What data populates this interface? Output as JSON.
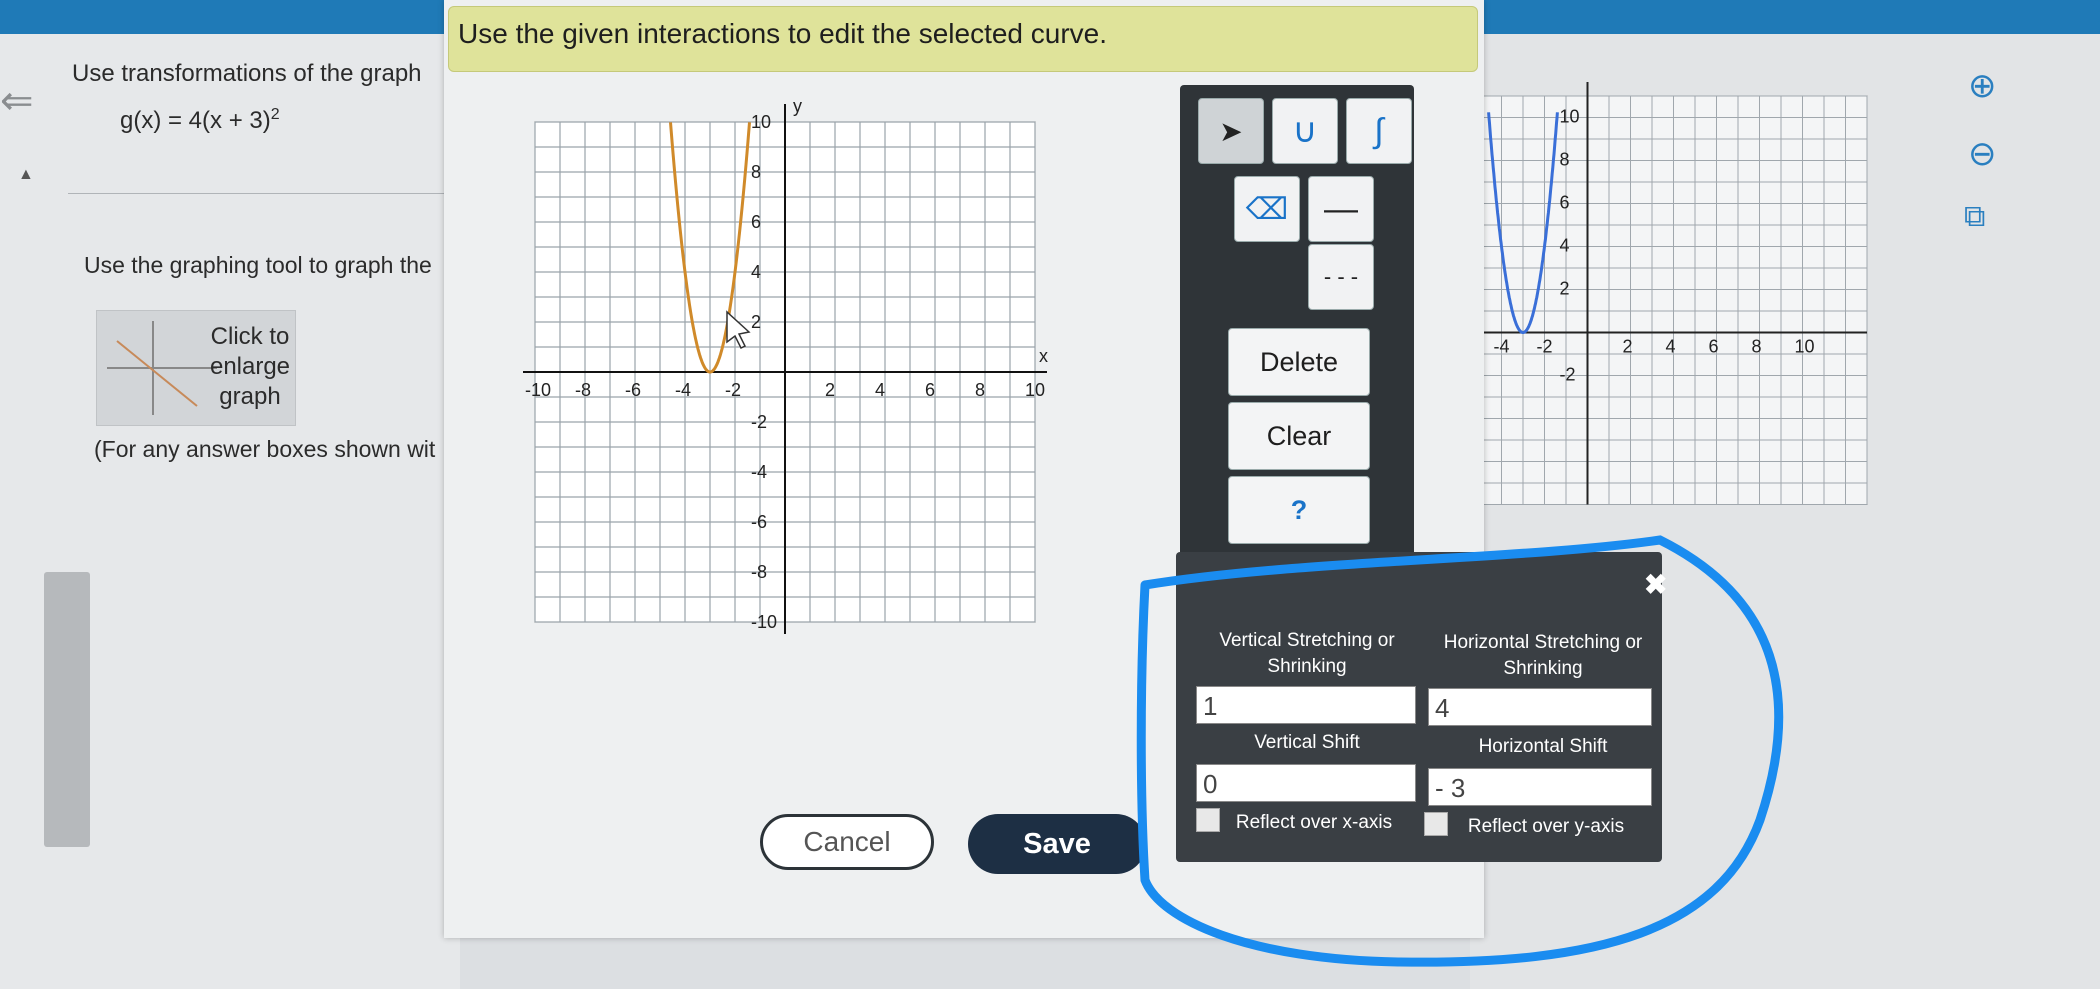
{
  "question": {
    "line1": "Use transformations of the graph",
    "formula": "g(x) = 4(x + 3)",
    "formula_exponent": "2",
    "line2": "Use the graphing tool to graph the",
    "thumbnail_text": "Click to enlarge graph",
    "note": "(For any answer boxes shown wit"
  },
  "modal": {
    "instruction": "Use the given interactions to edit the selected curve.",
    "cancel_label": "Cancel",
    "save_label": "Save"
  },
  "graph": {
    "axis_x": "x",
    "axis_y": "y",
    "x_ticks": [
      "-10",
      "-8",
      "-6",
      "-4",
      "-2",
      "2",
      "4",
      "6",
      "8",
      "10"
    ],
    "y_ticks": [
      "10",
      "8",
      "6",
      "4",
      "2",
      "-2",
      "-4",
      "-6",
      "-8",
      "-10"
    ],
    "curve_color": "#d08a2a",
    "curve_vertex": [
      -3,
      0
    ]
  },
  "preview_graph": {
    "curve_color": "#3a6fd8",
    "x_ticks": [
      "-4",
      "-2",
      "2",
      "4",
      "6",
      "8",
      "10"
    ],
    "y_ticks": [
      "10",
      "8",
      "6",
      "4",
      "2",
      "-2"
    ]
  },
  "toolbox": {
    "tools": [
      "arrow-icon",
      "parabola-icon",
      "curve-icon",
      "eraser-icon",
      "solid-line-icon",
      "dashed-line-icon"
    ],
    "delete_label": "Delete",
    "clear_label": "Clear",
    "help_label": "?"
  },
  "transform_panel": {
    "close_label": "✖",
    "vstretch_label": "Vertical Stretching or Shrinking",
    "hstretch_label": "Horizontal Stretching or Shrinking",
    "vstretch_value": "1",
    "hstretch_value": "4",
    "vshift_label": "Vertical Shift",
    "hshift_label": "Horizontal Shift",
    "vshift_value": "0",
    "hshift_value": "- 3",
    "reflect_x_label": "Reflect over x-axis",
    "reflect_y_label": "Reflect over y-axis"
  },
  "annotation_color": "#1a8cf0"
}
